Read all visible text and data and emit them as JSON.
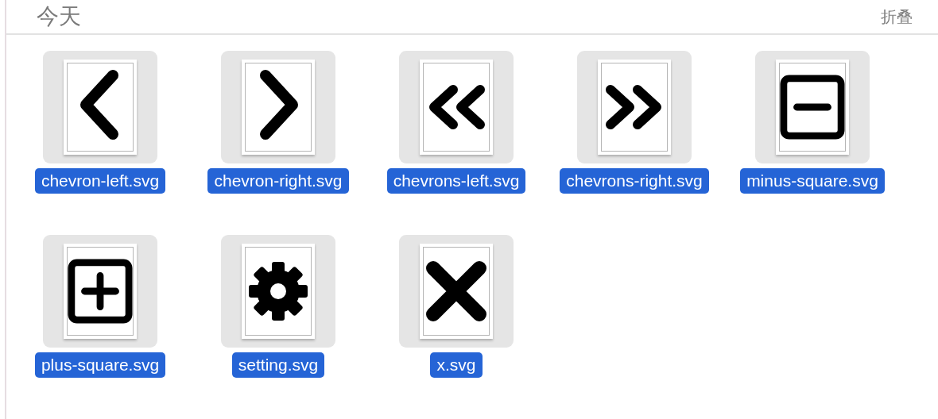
{
  "section": {
    "title": "今天",
    "collapse_button": "折叠"
  },
  "files": [
    {
      "name": "chevron-left.svg",
      "kind": "chevron-left",
      "selected": true
    },
    {
      "name": "chevron-right.svg",
      "kind": "chevron-right",
      "selected": true
    },
    {
      "name": "chevrons-left.svg",
      "kind": "chevrons-left",
      "selected": true
    },
    {
      "name": "chevrons-right.svg",
      "kind": "chevrons-right",
      "selected": true
    },
    {
      "name": "minus-square.svg",
      "kind": "minus-square",
      "selected": true
    },
    {
      "name": "plus-square.svg",
      "kind": "plus-square",
      "selected": true
    },
    {
      "name": "setting.svg",
      "kind": "setting",
      "selected": true
    },
    {
      "name": "x.svg",
      "kind": "x",
      "selected": true
    }
  ]
}
